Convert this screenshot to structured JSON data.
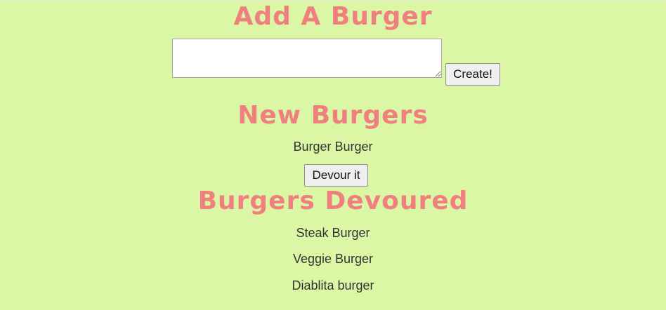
{
  "add_section": {
    "heading": "Add A Burger",
    "textarea_value": "",
    "create_label": "Create!"
  },
  "new_section": {
    "heading": "New Burgers",
    "burgers": [
      {
        "name": "Burger Burger",
        "action_label": "Devour it"
      }
    ]
  },
  "devoured_section": {
    "heading": "Burgers Devoured",
    "burgers": [
      "Steak Burger",
      "Veggie Burger",
      "Diablita burger"
    ]
  },
  "colors": {
    "background": "#dbf7a5",
    "heading": "#f08080"
  }
}
